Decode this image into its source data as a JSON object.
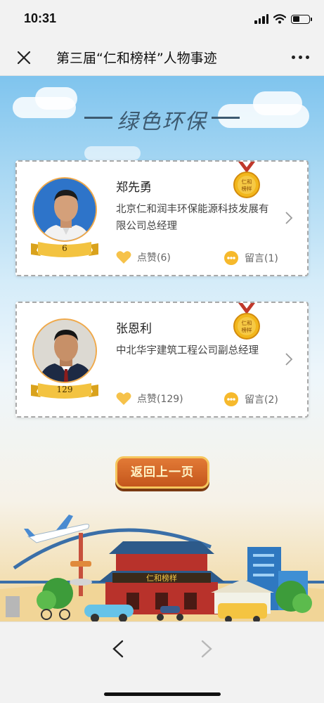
{
  "status_bar": {
    "time": "10:31"
  },
  "nav": {
    "title": "第三届“仁和榜样”人物事迹",
    "close_icon": "close-icon",
    "more_icon": "more-icon"
  },
  "section": {
    "title": "绿色环保"
  },
  "persons": [
    {
      "name": "郑先勇",
      "title": "北京仁和润丰环保能源科技发展有限公司总经理",
      "vote_count": "6",
      "like_label": "点赞(6)",
      "comment_label": "留言(1)",
      "medal_text": "仁和榜样"
    },
    {
      "name": "张恩利",
      "title": "中北华宇建筑工程公司副总经理",
      "vote_count": "129",
      "like_label": "点赞(129)",
      "comment_label": "留言(2)",
      "medal_text": "仁和榜样"
    }
  ],
  "back_button": {
    "label": "返回上一页"
  },
  "scene": {
    "sign_text": "仁和榜样"
  },
  "colors": {
    "accent_orange": "#e27a36",
    "ribbon_gold": "#f3c340",
    "ring": "#f0a94a",
    "section_title": "#3d5a70"
  }
}
